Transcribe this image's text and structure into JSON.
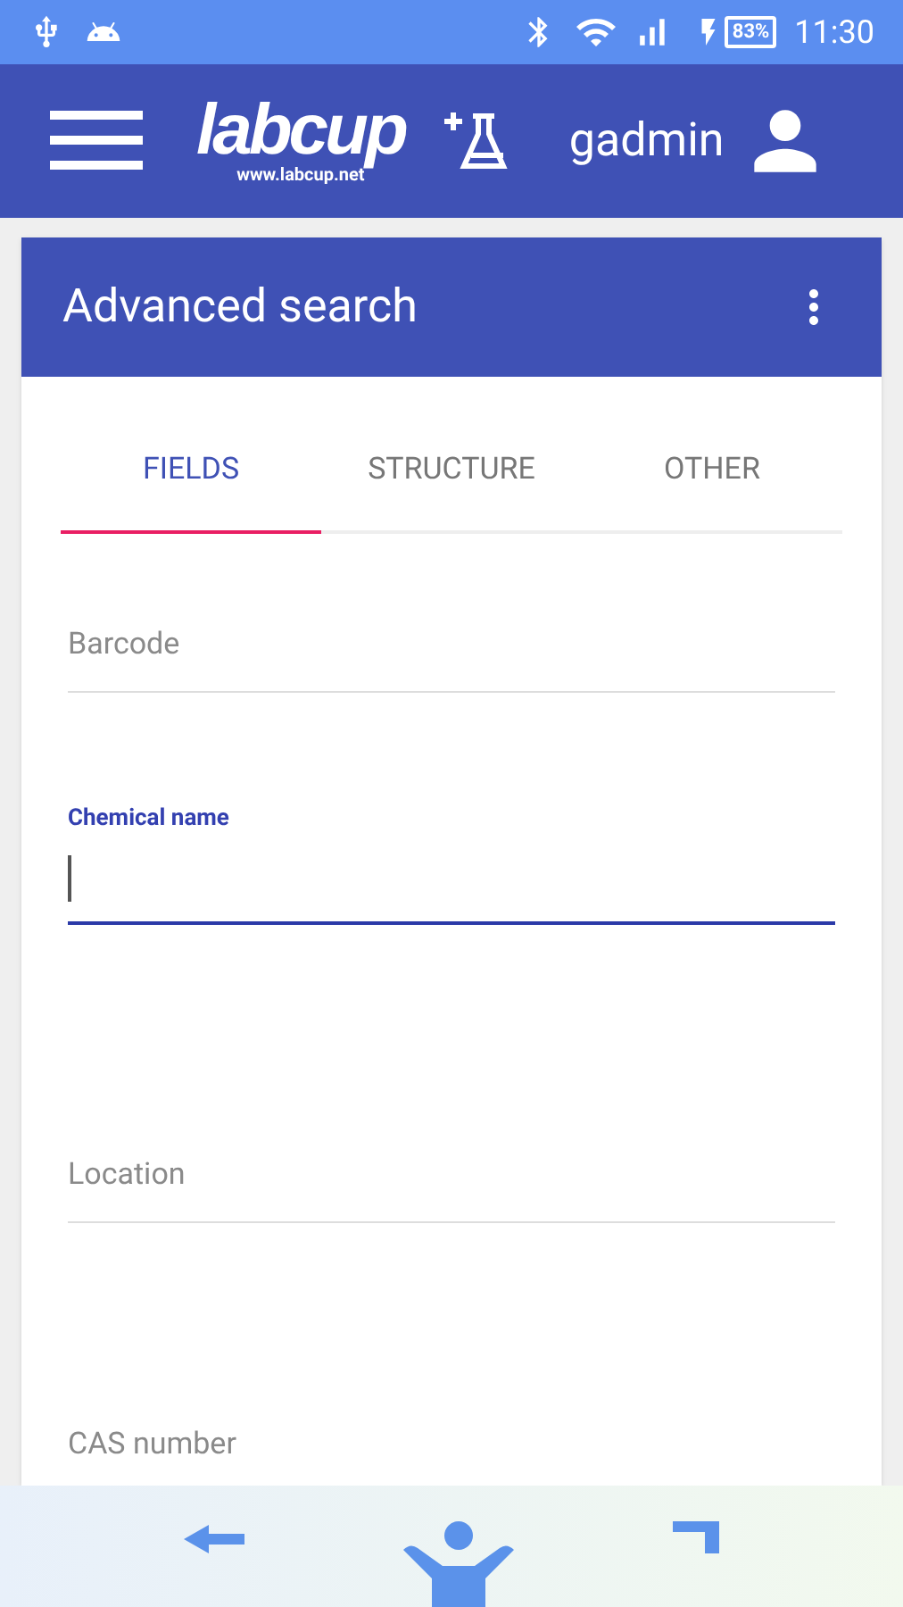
{
  "status_bar": {
    "battery": "83%",
    "time": "11:30"
  },
  "header": {
    "logo": "labcup",
    "logo_url": "www.labcup.net",
    "user": "gadmin"
  },
  "card": {
    "title": "Advanced search"
  },
  "tabs": [
    {
      "label": "FIELDS",
      "selected": true
    },
    {
      "label": "STRUCTURE",
      "selected": false
    },
    {
      "label": "OTHER",
      "selected": false
    }
  ],
  "fields": [
    {
      "label": "Barcode",
      "focused": false
    },
    {
      "label": "Chemical name",
      "focused": true
    },
    {
      "label": "Location",
      "focused": false
    },
    {
      "label": "CAS number",
      "focused": false
    }
  ]
}
